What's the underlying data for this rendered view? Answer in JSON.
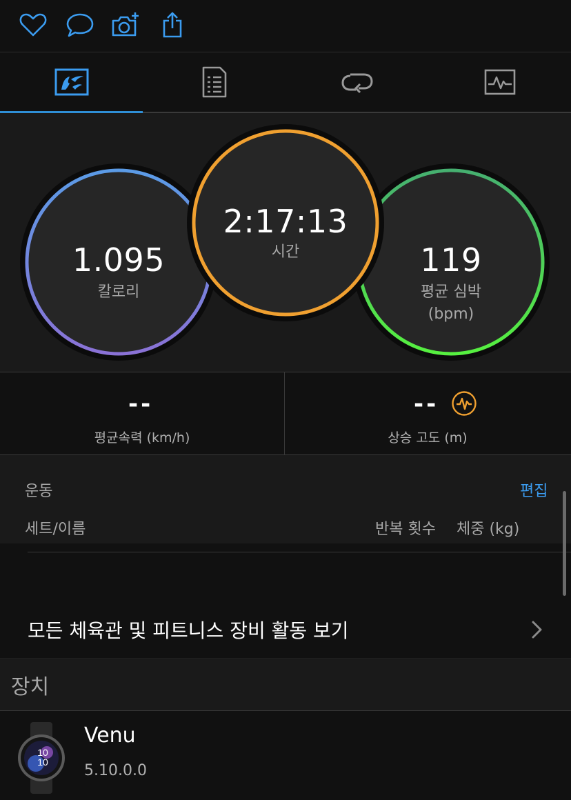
{
  "top_actions": [
    {
      "icon": "heart-icon"
    },
    {
      "icon": "comment-icon"
    },
    {
      "icon": "add-photo-icon"
    },
    {
      "icon": "share-icon"
    }
  ],
  "tabs": [
    {
      "icon": "activity-summary-icon",
      "active": true
    },
    {
      "icon": "details-list-icon",
      "active": false
    },
    {
      "icon": "laps-icon",
      "active": false
    },
    {
      "icon": "graph-icon",
      "active": false
    }
  ],
  "summary": {
    "calories": {
      "value": "1.095",
      "label": "칼로리"
    },
    "time": {
      "value": "2:17:13",
      "label": "시간"
    },
    "heart_rate": {
      "value": "119",
      "label_line1": "평균 심박",
      "label_line2": "(bpm)"
    }
  },
  "stats": {
    "avg_speed": {
      "value": "--",
      "label": "평균속력 (km/h)"
    },
    "elevation_gain": {
      "value": "--",
      "label": "상승 고도 (m)"
    }
  },
  "workout": {
    "title": "운동",
    "edit_label": "편집",
    "col_set_name": "세트/이름",
    "col_reps": "반복 횟수",
    "col_weight": "체중 (kg)"
  },
  "view_all": {
    "label": "모든 체육관 및 피트니스 장비 활동 보기"
  },
  "devices": {
    "title": "장치",
    "device_name": "Venu",
    "device_version": "5.10.0.0",
    "watch_time_hour": "10",
    "watch_time_min": "10"
  },
  "colors": {
    "accent_blue": "#3b9cf0",
    "time_orange": "#f0a030",
    "hr_green": "#4cd84c",
    "cal_blue": "#5b9be6",
    "cal_purple": "#8a72d6"
  }
}
